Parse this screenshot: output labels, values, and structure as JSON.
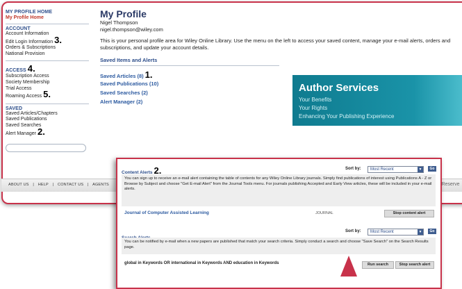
{
  "sidebar": {
    "profile_header": "MY PROFILE HOME",
    "profile_home": "My Profile Home",
    "account": {
      "header": "ACCOUNT",
      "items": [
        {
          "label": "Account Information",
          "num": ""
        },
        {
          "label": "Edit Login Information",
          "num": "3."
        },
        {
          "label": "Orders & Subscriptions",
          "num": ""
        },
        {
          "label": "National Provision",
          "num": ""
        }
      ]
    },
    "access": {
      "header": "ACCESS",
      "header_num": "4.",
      "items": [
        {
          "label": "Subscription Access",
          "num": ""
        },
        {
          "label": "Society Membership",
          "num": ""
        },
        {
          "label": "Trial Access",
          "num": ""
        },
        {
          "label": "Roaming Access",
          "num": "5."
        }
      ]
    },
    "saved": {
      "header": "SAVED",
      "items": [
        {
          "label": "Saved Articles/Chapters",
          "num": ""
        },
        {
          "label": "Saved Publications",
          "num": ""
        },
        {
          "label": "Saved Searches",
          "num": ""
        },
        {
          "label": "Alert Manager",
          "num": "2."
        }
      ]
    }
  },
  "main": {
    "title": "My Profile",
    "user_name": "Nigel Thompson",
    "user_email": "nigel.thompson@wiley.com",
    "intro": "This is your personal profile area for Wiley Online Library. Use the menu on the left to access your saved content, manage your e-mail alerts, orders and subscriptions, and update your account details.",
    "section_heading": "Saved Items and Alerts",
    "saved_items": [
      {
        "label": "Saved Articles (8)",
        "num": "1."
      },
      {
        "label": "Saved Publications (10)",
        "num": ""
      },
      {
        "label": "Saved Searches (2)",
        "num": ""
      },
      {
        "label": "Alert Manager (2)",
        "num": ""
      }
    ]
  },
  "banner": {
    "title": "Author Services",
    "lines": [
      "Your Benefits",
      "Your Rights",
      "Enhancing Your Publishing Experience"
    ]
  },
  "footer": {
    "links": [
      "ABOUT US",
      "|",
      "HELP",
      "|",
      "CONTACT US",
      "|",
      "AGENTS"
    ],
    "right_text": "s Reserve"
  },
  "popup": {
    "content_alerts": {
      "header": "Content Alerts",
      "num": "2.",
      "sort_label": "Sort by:",
      "sort_value": "Most Recent",
      "go": "Go",
      "text": "You can sign up to receive an e-mail alert containing the table of contents for any Wiley Online Library journals. Simply find publications of interest using Publications A - Z or Browse by Subject and choose \"Get E-mail Alert\" from the Journal Tools menu. For journals publishing Accepted and Early View articles, these will be included in your e-mail alerts.",
      "journal": "Journal of Computer Assisted Learning",
      "journal_type": "JOURNAL",
      "stop_button": "Stop content alert"
    },
    "search_alerts": {
      "header": "Search Alerts",
      "sort_label": "Sort by:",
      "sort_value": "Most Recent",
      "go": "Go",
      "text": "You can be notified by e-mail when a new papers are published that match your search criteria. Simply conduct a search and choose \"Save Search\" on the Search Results page.",
      "query": "global in Keywords OR international in Keywords AND education in Keywords",
      "run_button": "Run search",
      "stop_button": "Stop search alert"
    }
  },
  "colors": {
    "accent_border": "#c8324a",
    "link_blue": "#2c5aa0",
    "banner_teal": "#0f7b8f"
  }
}
